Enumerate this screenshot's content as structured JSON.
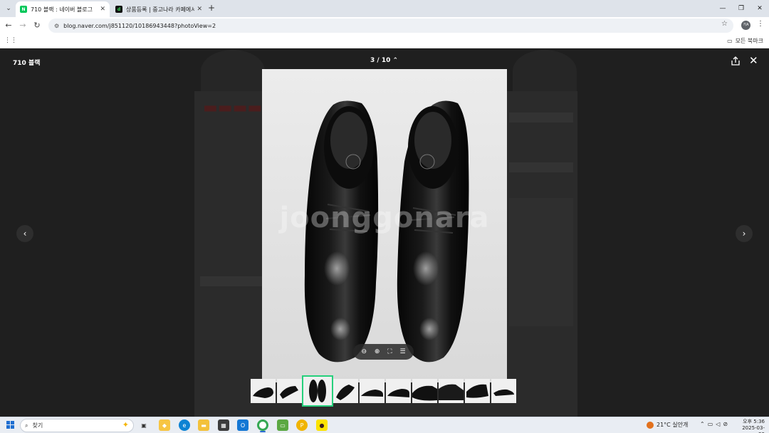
{
  "browser": {
    "tabs": [
      {
        "title": "710 블랙 : 네이버 블로그",
        "active": true
      },
      {
        "title": "상품등록 | 중고나라 카페에서",
        "active": false
      }
    ],
    "url": "blog.naver.com/j851120/10186943448?photoView=2",
    "profile_initial": "가A",
    "bookmarks_all": "모든 북마크"
  },
  "viewer": {
    "title": "710 블랙",
    "counter": "3 / 10",
    "watermark": "joonggonara",
    "total_thumbnails": 10,
    "selected_thumbnail": 3
  },
  "taskbar": {
    "search_placeholder": "찾기",
    "weather": "21°C  실안개",
    "time": "오후 5:36",
    "date": "2025-03-23"
  },
  "colors": {
    "selected_outline": "#26d07c",
    "viewer_bg": "#1f1f1f"
  }
}
